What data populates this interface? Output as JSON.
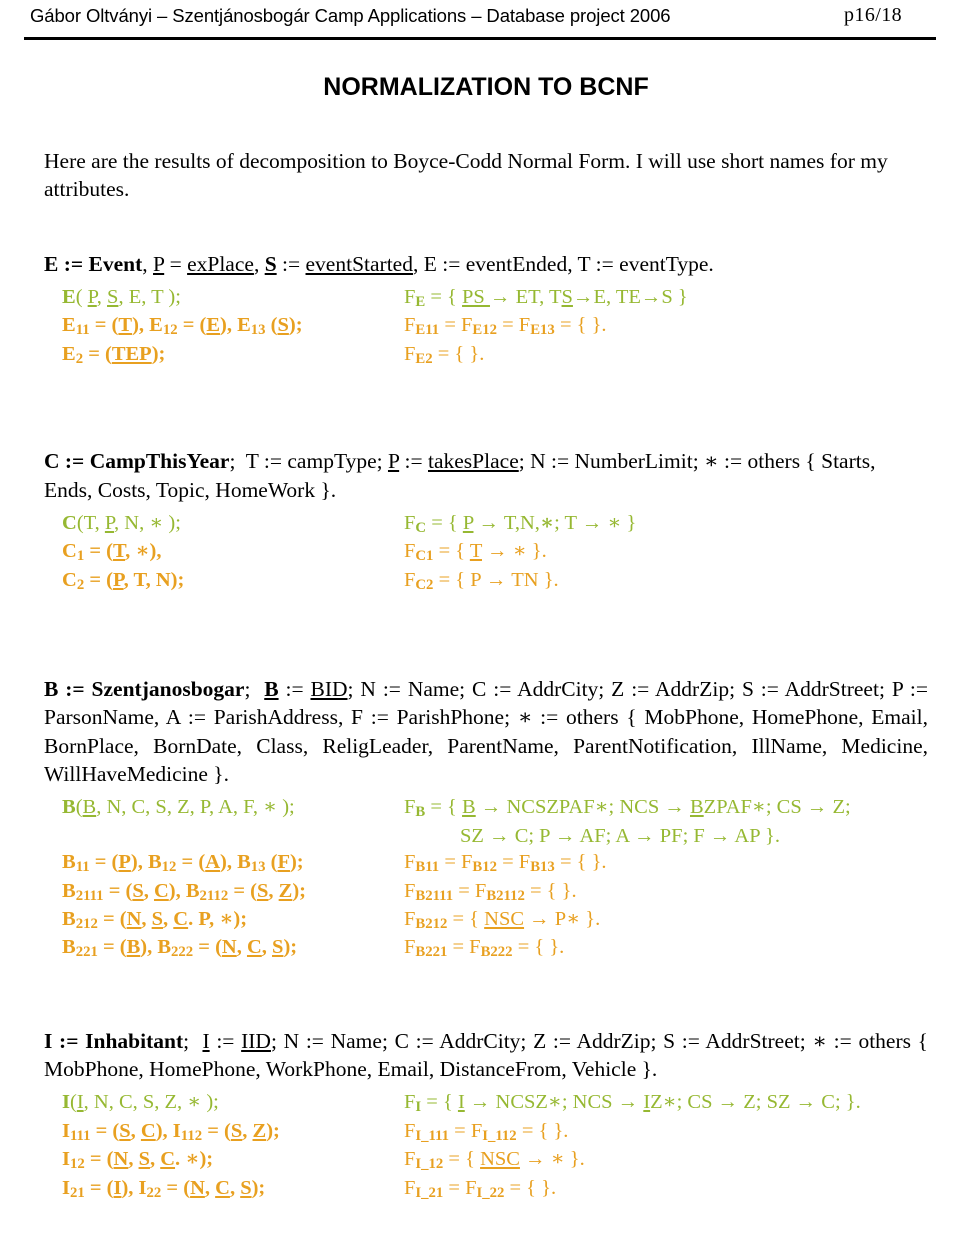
{
  "header": {
    "left": "Gábor Oltványi – Szentjánosbogár Camp Applications – Database project 2006",
    "right": "p16/18"
  },
  "title": "NORMALIZATION TO BCNF",
  "intro": "Here are the results of decomposition to Boyce-Codd Normal Form. I will use short names for my attributes.",
  "colors": {
    "green": "#96b832",
    "orange": "#e8a020",
    "black": "#000000"
  },
  "sections": [
    {
      "id": "E",
      "definition": "E := Event, P = exPlace, S := eventStarted, E := eventEnded, T := eventType.",
      "rows": [
        {
          "color": "green",
          "left": "E( P, S, E, T );",
          "right": "F E = { PS → ET, TS→E, TE→S }"
        },
        {
          "color": "orange",
          "left": "E11 = (T), E12 = (E), E13 (S);",
          "right": "F E11 = F E12 = F E13 = { }."
        },
        {
          "color": "orange",
          "left": "E2 = (TEP);",
          "right": "F E2 = { }."
        }
      ]
    },
    {
      "id": "C",
      "definition": "C := CampThisYear; T := campType; P := takesPlace; N := NumberLimit; ∗ := others { Starts, Ends, Costs, Topic, HomeWork }.",
      "rows": [
        {
          "color": "green",
          "left": "C(T, P, N, ∗ );",
          "right": "F C = { P → T,N,∗; T → ∗ }"
        },
        {
          "color": "orange",
          "left": "C1 = (T, ∗),",
          "right": "F C1 = { T → ∗ }."
        },
        {
          "color": "orange",
          "left": "C2 = (P, T, N);",
          "right": "F C2 = { P → TN }."
        }
      ]
    },
    {
      "id": "B",
      "definition": "B := Szentjanosbogar; B := BID; N := Name; C := AddrCity; Z := AddrZip; S := AddrStreet; P := ParsonName, A := ParishAddress, F := ParishPhone; ∗ := others { MobPhone, HomePhone, Email, BornPlace, BornDate, Class, ReligLeader, ParentName, ParentNotification, IllName, Medicine, WillHaveMedicine }.",
      "rows": [
        {
          "color": "green",
          "left": "B(B, N, C, S, Z, P, A, F, ∗ );",
          "right": "F B = { B → NCSZPAF∗; NCS → BZPAF∗; CS → Z;",
          "right2": "SZ → C; P → AF; A → PF; F → AP }."
        },
        {
          "color": "orange",
          "left": "B11 = (P), B12 = (A), B13 (F);",
          "right": "F B11 = F B12 = F B13 = { }."
        },
        {
          "color": "orange",
          "left": "B2111 = (S, C), B2112 = (S, Z);",
          "right": "F B2111 = F B2112 = { }."
        },
        {
          "color": "orange",
          "left": "B212 = (N, S, C. P, ∗);",
          "right": "F B212 = { NSC → P∗ }."
        },
        {
          "color": "orange",
          "left": "B221 = (B), B222 = (N, C, S);",
          "right": "F B221 = F B222 = { }."
        }
      ]
    },
    {
      "id": "I",
      "definition": "I := Inhabitant; I := IID; N := Name; C := AddrCity; Z := AddrZip; S := AddrStreet; ∗ := others { MobPhone, HomePhone, WorkPhone, Email, DistanceFrom, Vehicle }.",
      "rows": [
        {
          "color": "green",
          "left": "I(I, N, C, S, Z, ∗ );",
          "right": "F I = { I → NCSZ∗; NCS → IZ∗; CS → Z; SZ → C; }."
        },
        {
          "color": "orange",
          "left": "I111 = (S, C), I112 = (S, Z);",
          "right": "F I_111 = F I_112 = { }."
        },
        {
          "color": "orange",
          "left": "I12 = (N, S, C. ∗);",
          "right": "F I_12 = { NSC → ∗ }."
        },
        {
          "color": "orange",
          "left": "I21 = (I), I22 = (N, C, S);",
          "right": "F I_21 = F I_22 = { }."
        }
      ]
    }
  ]
}
